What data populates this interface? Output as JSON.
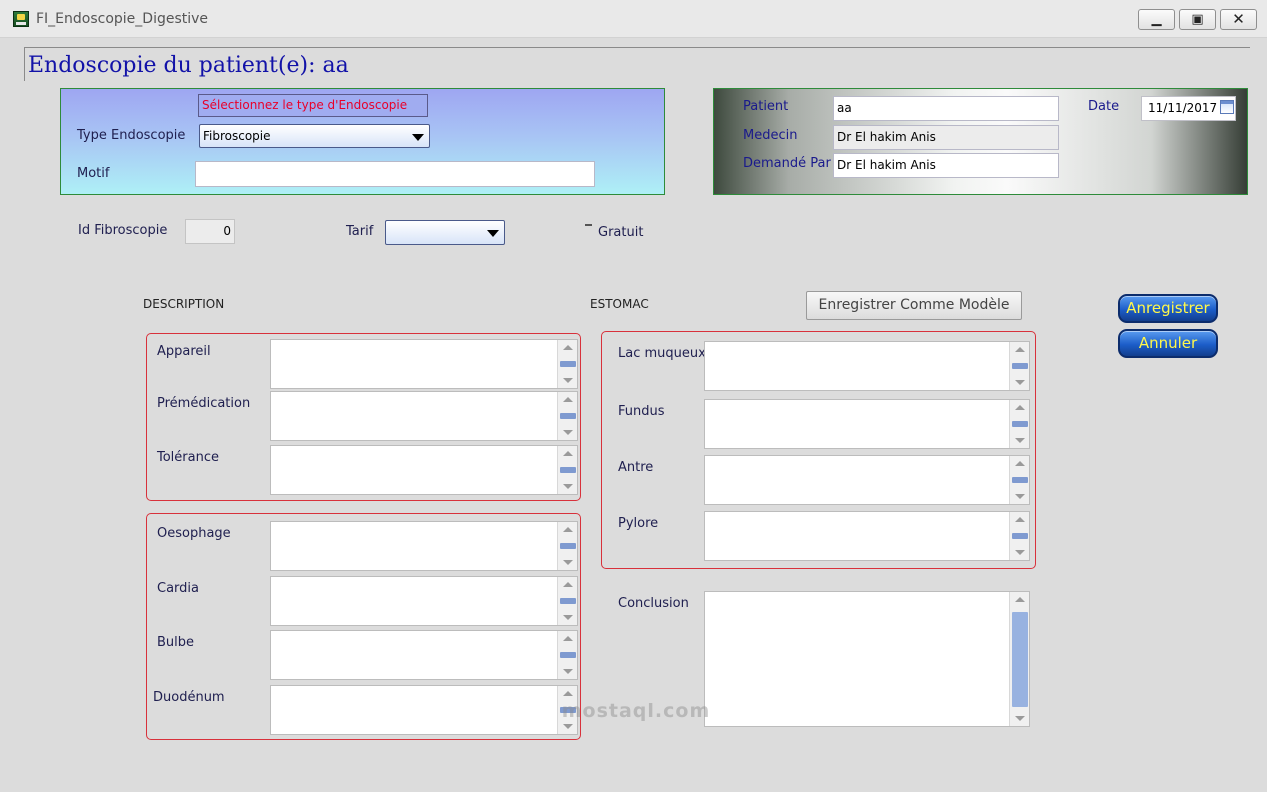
{
  "window": {
    "title": "FI_Endoscopie_Digestive",
    "minimize": "▁",
    "maximize": "▣",
    "close": "✕"
  },
  "page_title": "Endoscopie du patient(e): aa",
  "type_panel": {
    "hint": "Sélectionnez le type d'Endoscopie",
    "type_label": "Type Endoscopie",
    "type_value": "Fibroscopie",
    "motif_label": "Motif",
    "motif_value": ""
  },
  "patient_panel": {
    "patient_label": "Patient",
    "patient_value": "aa",
    "medecin_label": "Medecin",
    "medecin_value": "Dr El hakim Anis",
    "demande_label": "Demandé Par",
    "demande_value": "Dr El hakim Anis",
    "date_label": "Date",
    "date_value": "11/11/2017"
  },
  "meta_row": {
    "id_label": "Id Fibroscopie",
    "id_value": "0",
    "tarif_label": "Tarif",
    "tarif_value": "",
    "gratuit_label": "Gratuit"
  },
  "description": {
    "title": "DESCRIPTION",
    "group1": [
      "Appareil",
      "Prémédication",
      "Tolérance"
    ],
    "group2": [
      "Oesophage",
      "Cardia",
      "Bulbe",
      "Duodénum"
    ]
  },
  "estomac": {
    "title": "ESTOMAC",
    "fields": [
      "Lac muqueux",
      "Fundus",
      "Antre",
      "Pylore"
    ],
    "conclusion_label": "Conclusion"
  },
  "buttons": {
    "model": "Enregistrer Comme Modèle",
    "save": "Anregistrer",
    "cancel": "Annuler"
  },
  "watermark": "mostaql.com",
  "colors": {
    "title_blue": "#1212a8",
    "label_blue": "#1a1a8c",
    "hint_red": "#e8002a",
    "group_border_red": "#d8313b",
    "panel_border_green": "#2e8b3a",
    "button_text_yellow": "#fff84a"
  }
}
